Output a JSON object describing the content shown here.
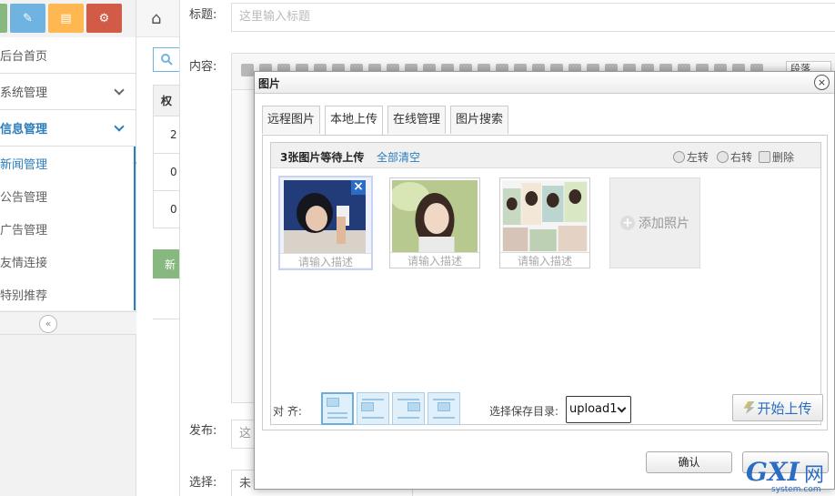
{
  "sidebar": {
    "shortcuts": [
      "check-icon",
      "pencil-icon",
      "book-icon",
      "cogs-icon"
    ],
    "items": [
      {
        "label": "后台首页"
      },
      {
        "label": "系统管理"
      },
      {
        "label": "信息管理"
      }
    ],
    "subitems": [
      {
        "label": "新闻管理"
      },
      {
        "label": "公告管理"
      },
      {
        "label": "广告管理"
      },
      {
        "label": "友情连接"
      },
      {
        "label": "特别推荐"
      }
    ],
    "collapse_icon": "«"
  },
  "mid": {
    "table_header": "权",
    "cells": [
      "2",
      "0",
      "0"
    ],
    "green_button": "新"
  },
  "form": {
    "title_label": "标题:",
    "title_placeholder": "这里输入标题",
    "content_label": "内容:",
    "paragraph_select": "段落",
    "publish_label": "发布:",
    "publish_value": "这",
    "select_label": "选择:",
    "select_value": "未"
  },
  "dialog": {
    "title": "图片",
    "close": "×",
    "tabs": [
      "远程图片",
      "本地上传",
      "在线管理",
      "图片搜索"
    ],
    "active_tab": 1,
    "queue_status": "3张图片等待上传",
    "clear_all": "全部清空",
    "rotate_left": "左转",
    "rotate_right": "右转",
    "delete": "删除",
    "thumbnails": [
      {
        "desc": "请输入描述",
        "selected": true
      },
      {
        "desc": "请输入描述",
        "selected": false
      },
      {
        "desc": "请输入描述",
        "selected": false
      }
    ],
    "add_photo": "添加照片",
    "align_label": "对 齐:",
    "save_dir_label": "选择保存目录:",
    "save_dir_value": "upload1",
    "start_upload": "开始上传",
    "confirm": "确认",
    "cancel": ""
  },
  "watermark": {
    "brand": "GXI",
    "wang": "网",
    "domain": "system.com"
  },
  "colors": {
    "accent": "#2b7dbc",
    "link": "#2b6cc4",
    "shortcut_green": "#87b87f",
    "shortcut_blue": "#6fb3e0",
    "shortcut_orange": "#ffb752",
    "shortcut_red": "#d15b47"
  }
}
